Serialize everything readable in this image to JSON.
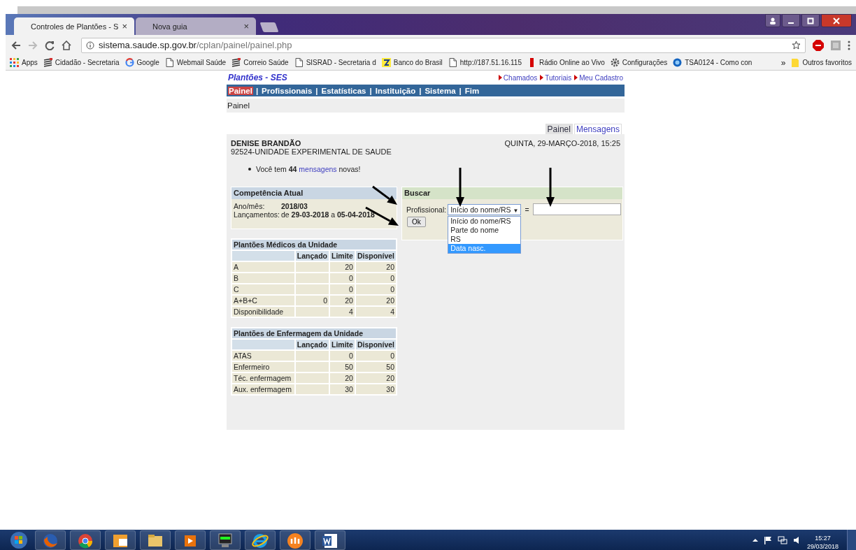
{
  "browser": {
    "tabs": [
      {
        "title": "Controles de Plantões - S",
        "close": "×",
        "selected": true
      },
      {
        "title": "Nova guia",
        "close": "×",
        "selected": false
      }
    ],
    "address": {
      "host": "sistema.saude.sp.gov.br",
      "path": "/cplan/painel/painel.php"
    },
    "bookmarks": [
      "Apps",
      "Cidadão - Secretaria",
      "Google",
      "Webmail Saúde",
      "Correio Saúde",
      "SISRAD - Secretaria d",
      "Banco do Brasil",
      "http://187.51.16.115",
      "Rádio Online ao Vivo",
      "Configurações",
      "TSA0124 - Como con"
    ],
    "overflow": "»",
    "other_bookmarks": "Outros favoritos"
  },
  "page": {
    "title": "Plantões - SES",
    "top_links": [
      "Chamados",
      "Tutoriais",
      "Meu Cadastro"
    ],
    "nav": [
      {
        "label": "Painel",
        "selected": true
      },
      {
        "label": "Profissionais",
        "selected": false
      },
      {
        "label": "Estatísticas",
        "selected": false
      },
      {
        "label": "Instituição",
        "selected": false
      },
      {
        "label": "Sistema",
        "selected": false
      },
      {
        "label": "Fim",
        "selected": false
      }
    ],
    "nav_separator": "|",
    "breadcrumb": "Painel",
    "tabs": [
      {
        "label": "Painel",
        "selected": true
      },
      {
        "label": "Mensagens",
        "selected": false
      }
    ],
    "user": "DENISE BRANDÃO",
    "unit": "92524-UNIDADE EXPERIMENTAL DE SAUDE",
    "date": "QUINTA, 29-MARÇO-2018, 15:25",
    "message": {
      "before": "Você tem **44**",
      "link": "mensagens",
      "after": "novas!"
    },
    "competencia": {
      "title": "Competência Atual",
      "rows": [
        {
          "label": "Ano/mês:",
          "value": "**2018/03**"
        },
        {
          "label": "Lançamentos:",
          "value": "de **29-03-2018** a **05-04-2018**"
        }
      ]
    },
    "buscar": {
      "title": "Buscar",
      "label": "Profissional:",
      "select_value": "Início do nome/RS",
      "select_caret": "▼",
      "equals": "=",
      "options": [
        {
          "label": "Início do nome/RS",
          "selected": false
        },
        {
          "label": "Parte do nome",
          "selected": false
        },
        {
          "label": "RS",
          "selected": false
        },
        {
          "label": "Data nasc.",
          "selected": true
        }
      ],
      "button": "Ok"
    },
    "tables": [
      {
        "title": "Plantões Médicos da Unidade",
        "columns": [
          "",
          "Lançado",
          "Limite",
          "Disponível"
        ],
        "rows": [
          [
            "A",
            "",
            "20",
            "20"
          ],
          [
            "B",
            "",
            "0",
            "0"
          ],
          [
            "C",
            "",
            "0",
            "0"
          ],
          [
            "A+B+C",
            "0",
            "20",
            "20"
          ],
          [
            "Disponibilidade",
            "",
            "4",
            "4"
          ]
        ]
      },
      {
        "title": "Plantões de Enfermagem da Unidade",
        "columns": [
          "",
          "Lançado",
          "Limite",
          "Disponível"
        ],
        "rows": [
          [
            "ATAS",
            "",
            "0",
            "0"
          ],
          [
            "Enfermeiro",
            "",
            "50",
            "50"
          ],
          [
            "Téc. enfermagem",
            "",
            "20",
            "20"
          ],
          [
            "Aux. enfermagem",
            "",
            "30",
            "30"
          ]
        ]
      }
    ]
  },
  "taskbar": {
    "time": "15:27",
    "date": "29/03/2018"
  }
}
